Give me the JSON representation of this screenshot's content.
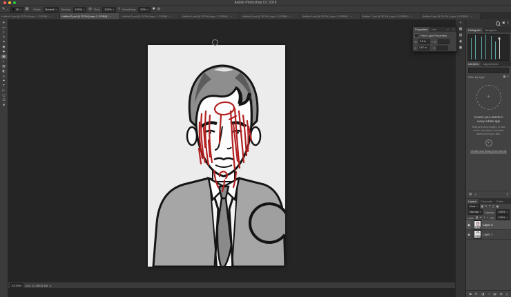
{
  "window": {
    "title": "Adobe Photoshop CC 2018"
  },
  "ui": {
    "caret": "▾",
    "close": "×",
    "chev_right": "▸",
    "collapse": "«",
    "link_icon": "∞",
    "plus": "+",
    "eye": "◉",
    "fx": "fx"
  },
  "options": {
    "tool_glyph": "✎",
    "brush_size": "30",
    "mode_label": "Mode:",
    "mode_value": "Normal",
    "opacity_label": "Opacity:",
    "opacity_value": "100%",
    "flow_label": "Flow:",
    "flow_value": "100%",
    "smoothing_label": "Smoothing:",
    "smoothing_value": "10%"
  },
  "tabs": [
    {
      "label": "Untitled-1.psd @ 33.3% (Layer 1, RGB/8) *"
    },
    {
      "label": "Untitled-2.psd @ 33.3% (Layer 2, RGB/8) *"
    },
    {
      "label": "Untitled-3.psd @ 33.3% (Layer 1, RGB/8) *"
    },
    {
      "label": "Untitled-4.psd @ 33.3% (Layer 1, RGB/8) *"
    },
    {
      "label": "Untitled-5.psd @ 33.3% (Layer 1, RGB/8) *"
    },
    {
      "label": "Untitled-6.psd @ 33.3% (Layer 1, RGB/8) *"
    },
    {
      "label": "Untitled-7.psd @ 33.3% (Layer 1, RGB/8) *"
    },
    {
      "label": "Untitled-8.psd @ 33.3% (Layer 1, RGB/8) *"
    }
  ],
  "tools": [
    {
      "name": "move-tool",
      "glyph": "✛"
    },
    {
      "name": "marquee-tool",
      "glyph": "▭"
    },
    {
      "name": "lasso-tool",
      "glyph": "⌇"
    },
    {
      "name": "quick-select-tool",
      "glyph": "✎"
    },
    {
      "name": "crop-tool",
      "glyph": "⌗"
    },
    {
      "name": "eyedropper-tool",
      "glyph": "◉"
    },
    {
      "name": "healing-tool",
      "glyph": "✚"
    },
    {
      "name": "brush-tool",
      "glyph": "▣"
    },
    {
      "name": "clone-stamp-tool",
      "glyph": "◐"
    },
    {
      "name": "history-brush-tool",
      "glyph": "▨"
    },
    {
      "name": "eraser-tool",
      "glyph": "◧"
    },
    {
      "name": "gradient-tool",
      "glyph": "△"
    },
    {
      "name": "pen-tool",
      "glyph": "✒"
    },
    {
      "name": "type-tool",
      "glyph": "T"
    },
    {
      "name": "path-select-tool",
      "glyph": "▷"
    },
    {
      "name": "shape-tool",
      "glyph": "▢"
    },
    {
      "name": "hand-tool",
      "glyph": "☐"
    },
    {
      "name": "zoom-tool",
      "glyph": "⊕"
    }
  ],
  "collapse_icons": [
    "▦",
    "▤",
    "◉",
    "▣"
  ],
  "props": {
    "tab_properties": "Properties",
    "tab_info": "Info",
    "header": "Pixel Layer Properties",
    "w_label": "W:",
    "w_value": "3.5 in",
    "h_label": "H:",
    "h_value": "",
    "x_label": "X:",
    "x_value": "2.67 in",
    "y_label": "Y:",
    "y_value": ""
  },
  "histogram": {
    "tab_histogram": "Histogram",
    "tab_navigator": "Navigator"
  },
  "libraries": {
    "tab_libraries": "Libraries",
    "tab_adjustments": "Adjustments",
    "filter_label": "Filter by Type",
    "headline": "Access your assets in every Adobe app",
    "body": "Drag and drop images, or add colors, text styles, and other assets from your files.",
    "link": "Create new library from this file",
    "foot_icons": [
      "▤",
      "≡"
    ],
    "trash_icon": "▯"
  },
  "layers": {
    "tab_layers": "Layers",
    "tab_channels": "Channels",
    "tab_paths": "Paths",
    "kind_label": "Kind",
    "filter_icons": [
      "▦",
      "✎",
      "T",
      "▢",
      "▣"
    ],
    "blend_mode": "Normal",
    "opacity_label": "Opacity:",
    "opacity_value": "100%",
    "lock_label": "Lock:",
    "lock_icons": [
      "▨",
      "✛",
      "⊹",
      "▪"
    ],
    "fill_label": "Fill:",
    "fill_value": "100%",
    "items": [
      {
        "name": "Layer 2"
      },
      {
        "name": "Layer 1"
      }
    ],
    "foot_icons": [
      "⧉",
      "fx",
      "◨",
      "◑",
      "▤",
      "⊞",
      "▯"
    ]
  },
  "status": {
    "zoom": "33.33%",
    "doc": "Doc: 22.3M/44.6M"
  }
}
